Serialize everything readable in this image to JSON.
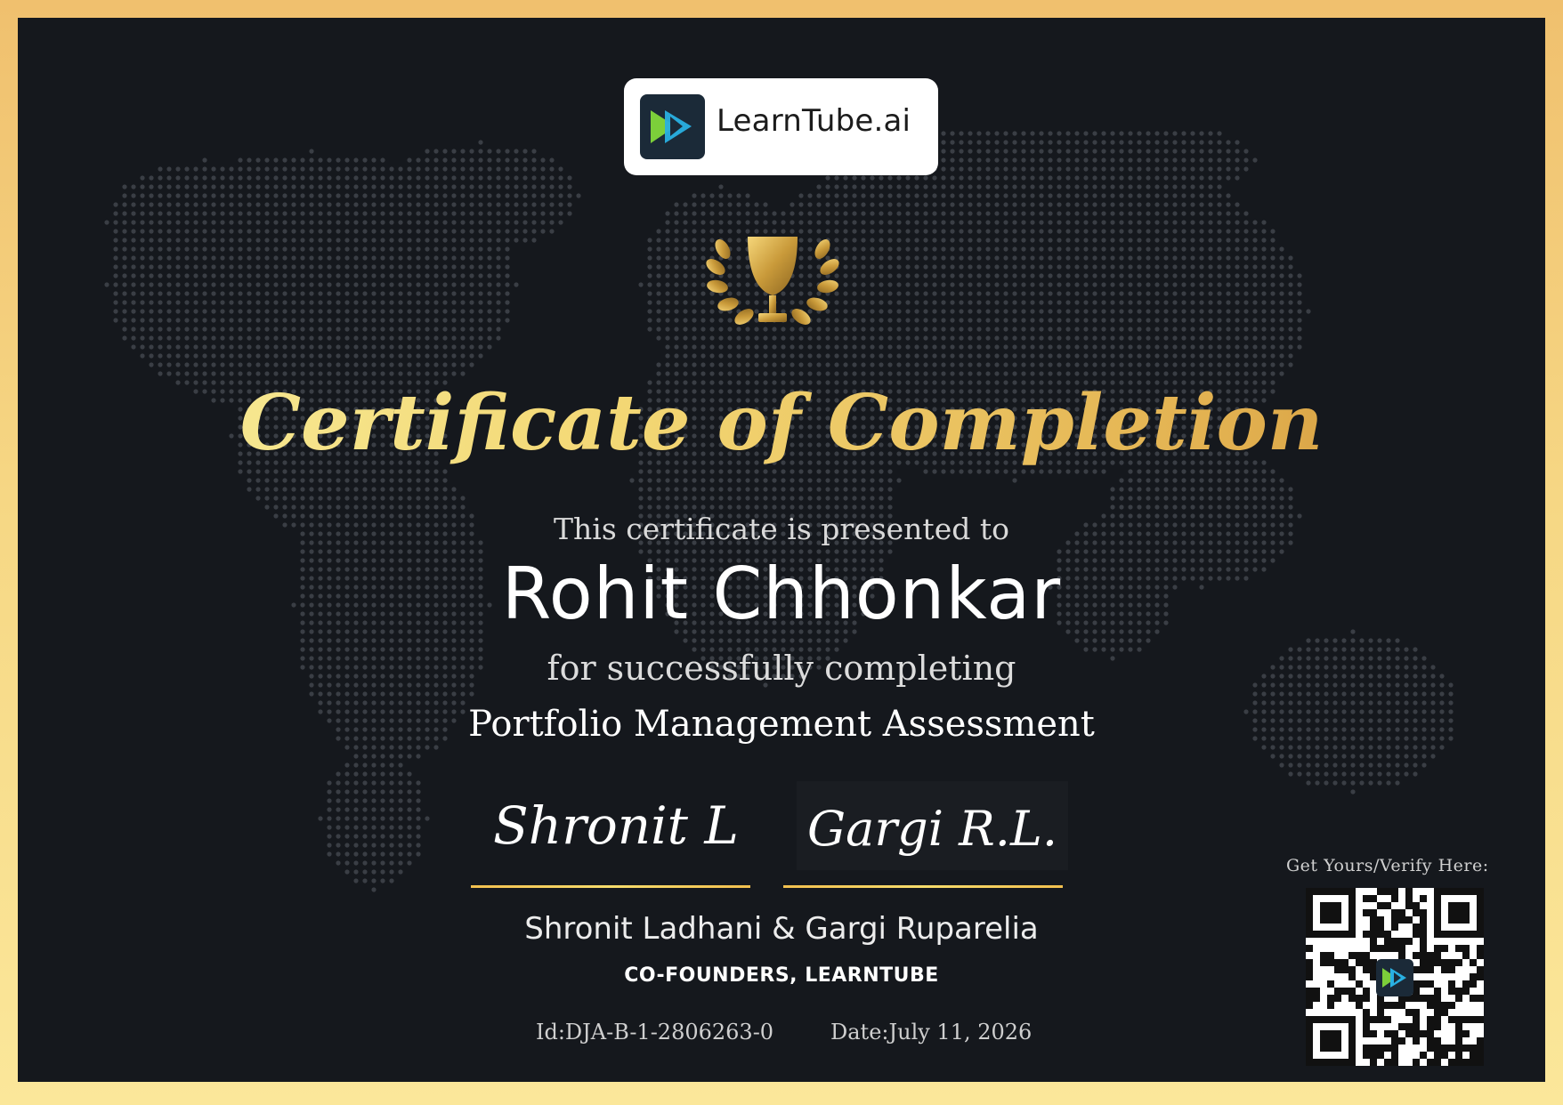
{
  "brand": {
    "logo_text": "LearnTube.ai",
    "colors": {
      "gold": "#f3d774",
      "panel": "#15181d",
      "frame": "#f2c56f"
    }
  },
  "certificate": {
    "title": "Certificate of Completion",
    "presented_text": "This certificate is presented to",
    "recipient": "Rohit Chhonkar",
    "completing_text": "for successfully completing",
    "course": "Portfolio Management Assessment"
  },
  "signatures": {
    "signature_1": "Shronit L",
    "signature_2": "Gargi R.L.",
    "names": "Shronit Ladhani & Gargi Ruparelia",
    "role": "CO-FOUNDERS, LEARNTUBE"
  },
  "meta": {
    "id": "Id:DJA-B-1-2806263-0",
    "date": "Date:July 11, 2026"
  },
  "verify": {
    "label": "Get Yours/Verify Here:"
  },
  "icons": {
    "logo": "play-forward-icon",
    "trophy": "trophy-laurel-icon",
    "qr": "qr-code"
  }
}
